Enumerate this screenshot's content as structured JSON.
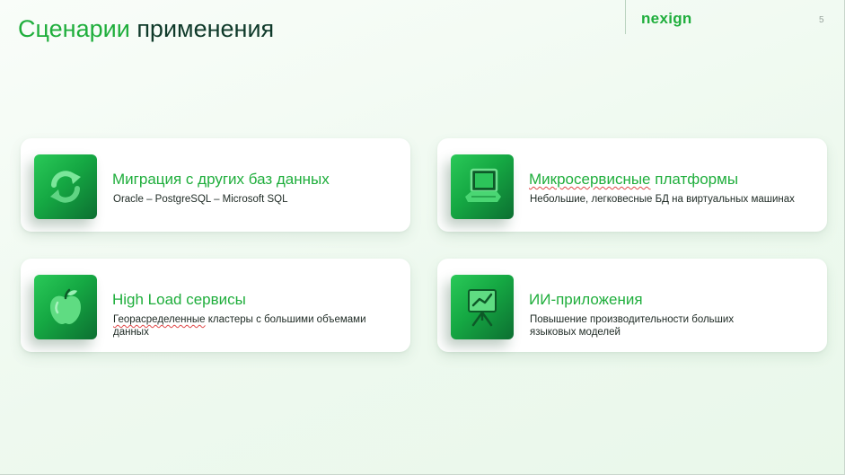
{
  "header": {
    "title_part1": "Сценарии",
    "title_part2": "применения",
    "logo": "nexign",
    "page_number": "5"
  },
  "colors": {
    "accent": "#1fae3c",
    "dark_text": "#0f3a2a",
    "background": "#eef9ef"
  },
  "cards": [
    {
      "icon": "refresh-icon",
      "title": "Миграция с других баз данных",
      "desc": "Oracle – PostgreSQL – Microsoft SQL"
    },
    {
      "icon": "laptop-icon",
      "title_word1": "Микросервисные",
      "title_rest": " платформы",
      "desc": "Небольшие, легковесные БД на виртуальных машинах"
    },
    {
      "icon": "apple-icon",
      "title": "High Load сервисы",
      "desc_word1": "Георасределенные",
      "desc_rest": " кластеры с большими объемами данных"
    },
    {
      "icon": "presentation-board-icon",
      "title": "ИИ-приложения",
      "desc": "Повышение производительности больших языковых моделей"
    }
  ]
}
